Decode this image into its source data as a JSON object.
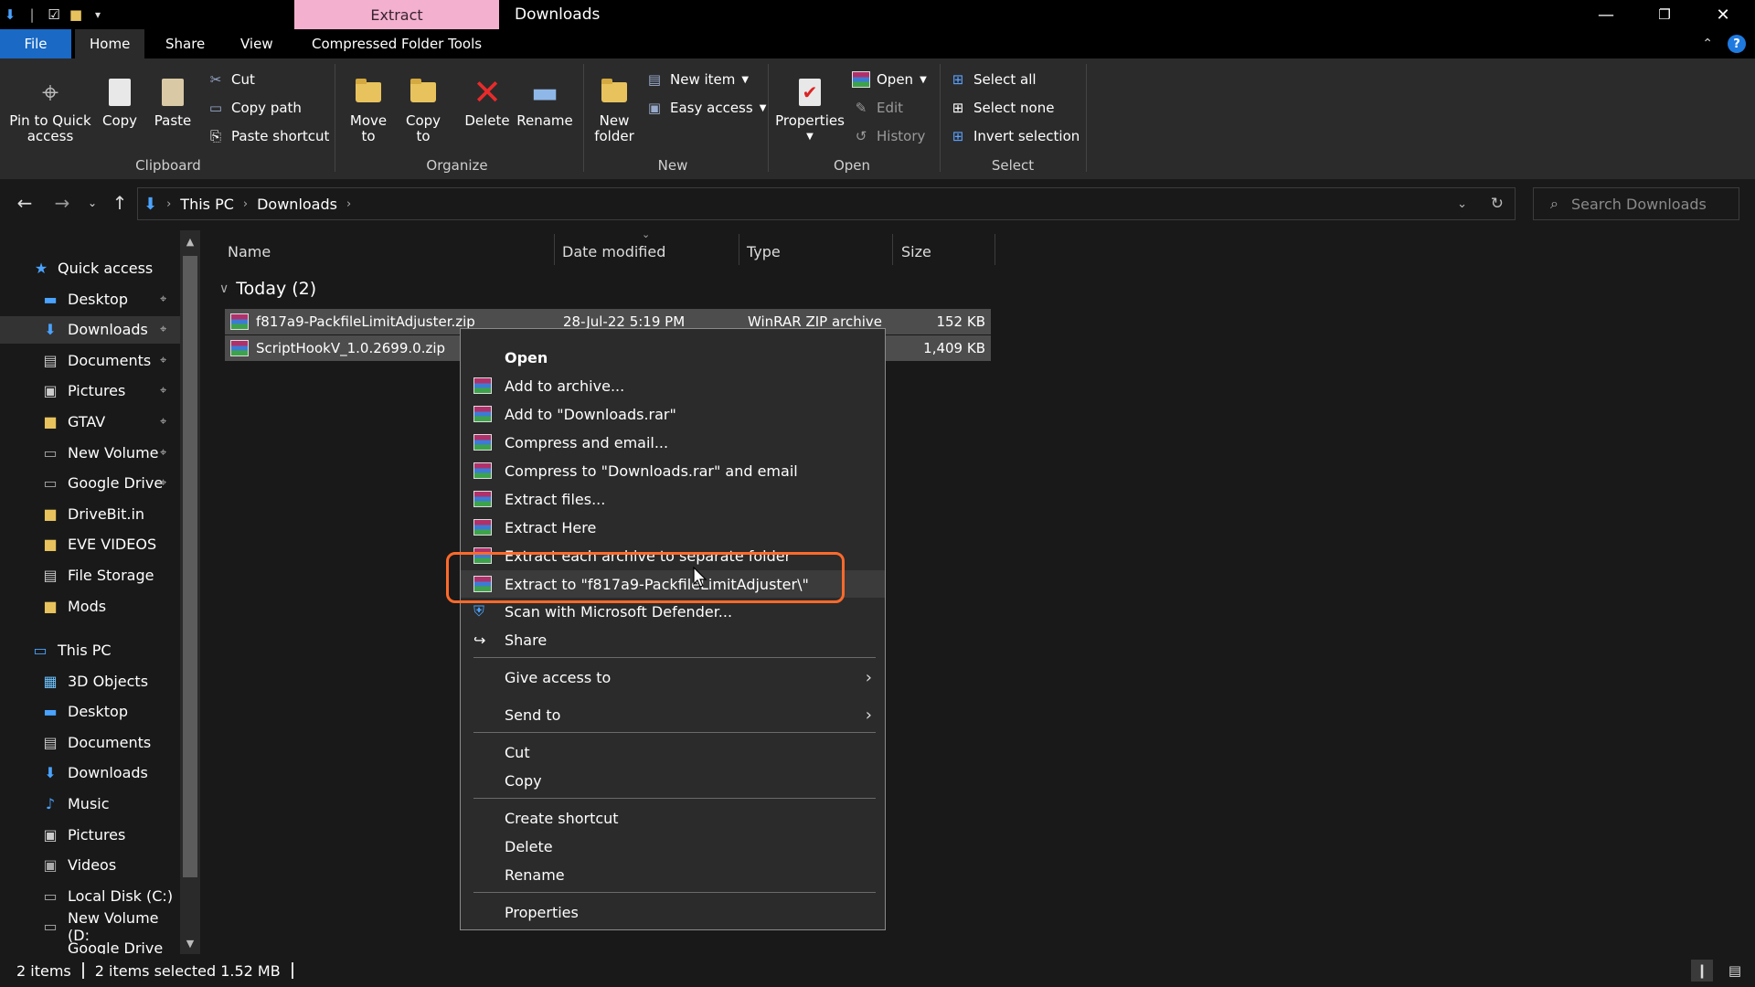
{
  "window": {
    "contextual_tab_header": "Extract",
    "title": "Downloads"
  },
  "ribbon_tabs": [
    "File",
    "Home",
    "Share",
    "View",
    "Compressed Folder Tools"
  ],
  "ribbon": {
    "clipboard": {
      "pin": "Pin to Quick access",
      "copy": "Copy",
      "paste": "Paste",
      "cut": "Cut",
      "copy_path": "Copy path",
      "paste_shortcut": "Paste shortcut",
      "label": "Clipboard"
    },
    "organize": {
      "move_to": "Move to",
      "copy_to": "Copy to",
      "delete": "Delete",
      "rename": "Rename",
      "label": "Organize"
    },
    "new": {
      "new_folder": "New folder",
      "new_item": "New item",
      "easy_access": "Easy access",
      "label": "New"
    },
    "open": {
      "properties": "Properties",
      "open": "Open",
      "edit": "Edit",
      "history": "History",
      "label": "Open"
    },
    "select": {
      "select_all": "Select all",
      "select_none": "Select none",
      "invert": "Invert selection",
      "label": "Select"
    }
  },
  "address": {
    "crumbs": [
      "This PC",
      "Downloads"
    ],
    "search_placeholder": "Search Downloads"
  },
  "nav": {
    "quick_access": "Quick access",
    "quick_items": [
      "Desktop",
      "Downloads",
      "Documents",
      "Pictures",
      "GTAV",
      "New Volume",
      "Google Drive",
      "DriveBit.in",
      "EVE VIDEOS",
      "File Storage",
      "Mods"
    ],
    "this_pc": "This PC",
    "pc_items": [
      "3D Objects",
      "Desktop",
      "Documents",
      "Downloads",
      "Music",
      "Pictures",
      "Videos",
      "Local Disk (C:)",
      "New Volume (D:",
      "Google Drive (G:"
    ]
  },
  "columns": [
    "Name",
    "Date modified",
    "Type",
    "Size"
  ],
  "group": "Today (2)",
  "files": [
    {
      "name": "f817a9-PackfileLimitAdjuster.zip",
      "date": "28-Jul-22 5:19 PM",
      "type": "WinRAR ZIP archive",
      "size": "152 KB"
    },
    {
      "name": "ScriptHookV_1.0.2699.0.zip",
      "size": "1,409 KB"
    }
  ],
  "context_menu": {
    "open": "Open",
    "rar_items": [
      "Add to archive...",
      "Add to \"Downloads.rar\"",
      "Compress and email...",
      "Compress to \"Downloads.rar\" and email",
      "Extract files...",
      "Extract Here",
      "Extract each archive to separate folder",
      "Extract to \"f817a9-PackfileLimitAdjuster\\\""
    ],
    "scan": "Scan with Microsoft Defender...",
    "share": "Share",
    "give_access": "Give access to",
    "send_to": "Send to",
    "cut": "Cut",
    "copy": "Copy",
    "create_shortcut": "Create shortcut",
    "delete": "Delete",
    "rename": "Rename",
    "properties": "Properties"
  },
  "status": {
    "items": "2 items",
    "selected": "2 items selected  1.52 MB"
  },
  "colors": {
    "file_tab": "#1969c5",
    "contextual_tab": "#f3b1cf",
    "highlight_ring": "#ff6a2b"
  }
}
